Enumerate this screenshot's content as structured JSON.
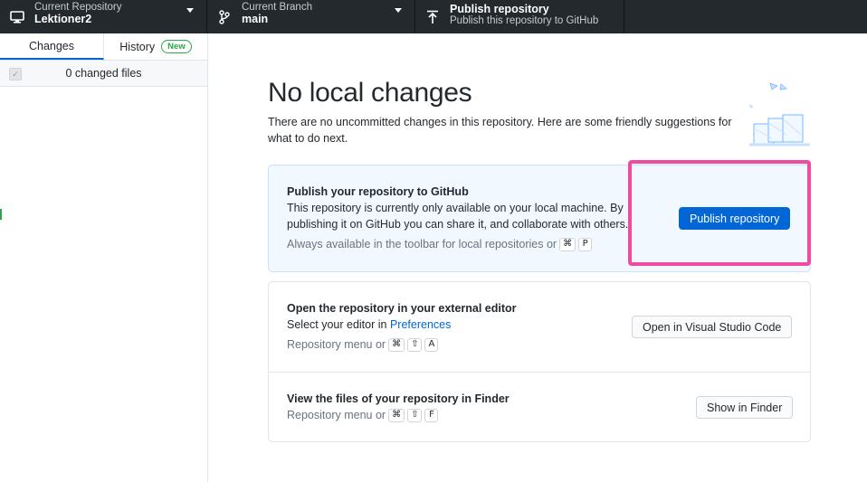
{
  "toolbar": {
    "repo": {
      "label": "Current Repository",
      "value": "Lektioner2",
      "icon": "desktop-icon"
    },
    "branch": {
      "label": "Current Branch",
      "value": "main",
      "icon": "git-branch-icon"
    },
    "publish": {
      "title": "Publish repository",
      "desc": "Publish this repository to GitHub",
      "icon": "upload-icon"
    }
  },
  "sidebar": {
    "tabs": [
      {
        "label": "Changes"
      },
      {
        "label": "History",
        "badge": "New"
      }
    ],
    "changed_files": "0 changed files"
  },
  "main": {
    "heading": "No local changes",
    "subtext": "There are no uncommitted changes in this repository. Here are some friendly suggestions for what to do next.",
    "publish_card": {
      "title": "Publish your repository to GitHub",
      "desc": "This repository is currently only available on your local machine. By publishing it on GitHub you can share it, and collaborate with others.",
      "hint": "Always available in the toolbar for local repositories or",
      "keys": [
        "⌘",
        "P"
      ],
      "button": "Publish repository"
    },
    "editor_card": {
      "title": "Open the repository in your external editor",
      "desc_prefix": "Select your editor in",
      "desc_link": "Preferences",
      "hint": "Repository menu or",
      "keys": [
        "⌘",
        "⇧",
        "A"
      ],
      "button": "Open in Visual Studio Code"
    },
    "finder_card": {
      "title": "View the files of your repository in Finder",
      "hint": "Repository menu or",
      "keys": [
        "⌘",
        "⇧",
        "F"
      ],
      "button": "Show in Finder"
    }
  },
  "colors": {
    "toolbar_bg": "#24292e",
    "accent": "#0366d6",
    "highlight": "#ef4ba3",
    "new_badge": "#28a745"
  }
}
